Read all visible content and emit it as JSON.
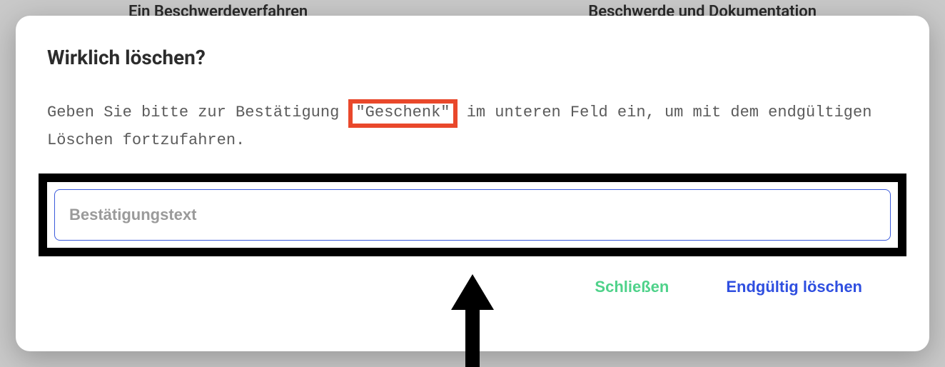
{
  "backdrop": {
    "left_text": "Ein Beschwerdeverfahren",
    "right_text": "Beschwerde und Dokumentation"
  },
  "modal": {
    "title": "Wirklich löschen?",
    "message_prefix": "Geben Sie bitte zur Bestätigung ",
    "message_keyword": "\"Geschenk\"",
    "message_suffix": " im unteren Feld ein, um mit dem endgültigen Löschen fortzufahren.",
    "input_placeholder": "Bestätigungstext",
    "close_label": "Schließen",
    "delete_label": "Endgültig löschen"
  },
  "annotations": {
    "highlight_color": "#e9482b",
    "input_frame_color": "#000000"
  }
}
